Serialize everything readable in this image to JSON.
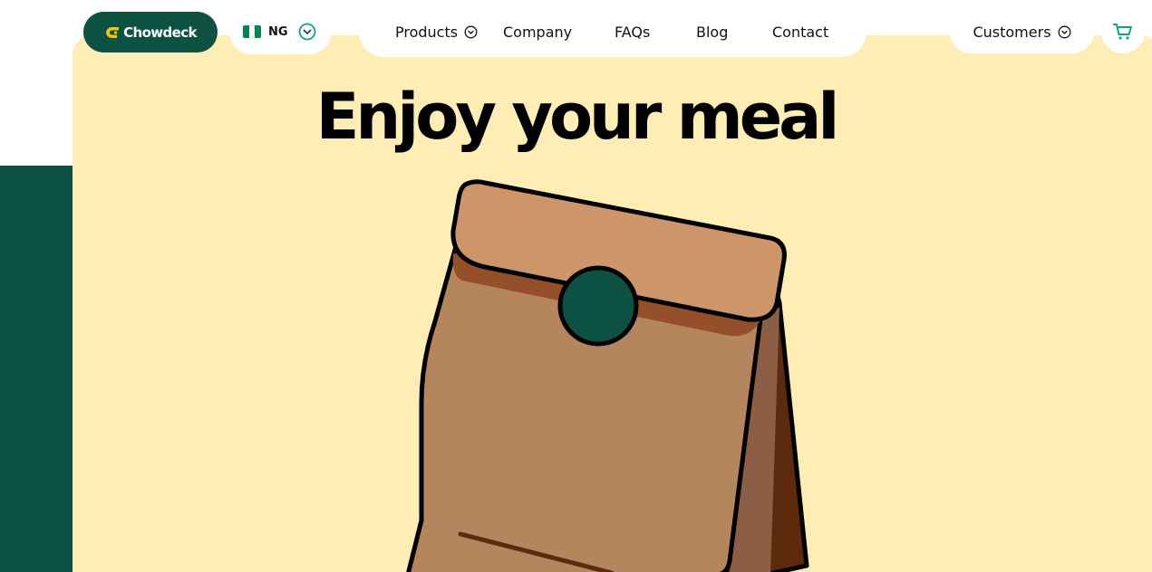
{
  "header": {
    "logo": {
      "text": "Chowdeck",
      "icon": "chowdeck-logo-icon"
    },
    "country": {
      "code": "NG",
      "flag_colors": [
        "#008751",
        "#ffffff",
        "#008751"
      ],
      "icon": "chevron-down-circle-icon"
    },
    "nav": {
      "items": [
        {
          "label": "Products",
          "has_dropdown": true,
          "icon": "chevron-down-circle-icon"
        },
        {
          "label": "Company"
        },
        {
          "label": "FAQs"
        },
        {
          "label": "Blog"
        },
        {
          "label": "Contact"
        }
      ]
    },
    "customers": {
      "label": "Customers",
      "icon": "chevron-down-circle-icon"
    },
    "cart": {
      "icon": "cart-icon"
    }
  },
  "hero": {
    "title": "Enjoy your meal",
    "illustration": "paper-bag-illustration"
  },
  "colors": {
    "brand_green": "#0c5142",
    "hero_background": "#feedb4",
    "logo_accent": "#f7c600",
    "accent_teal": "#0fa37f",
    "bag_body": "#b5865d",
    "bag_flap": "#cd966a",
    "bag_side": "#5e2a0e"
  }
}
